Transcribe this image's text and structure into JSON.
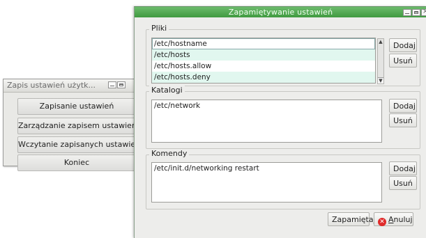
{
  "background_window": {
    "title": "Zapis ustawień użytk...",
    "buttons": [
      "Zapisanie ustawień",
      "Zarządzanie zapisem ustawień",
      "Wczytanie zapisanych ustawień",
      "Koniec"
    ]
  },
  "dialog": {
    "title": "Zapamiętywanie ustawień",
    "pliki": {
      "label": "Pliki",
      "items": [
        "/etc/hostname",
        "/etc/hosts",
        "/etc/hosts.allow",
        "/etc/hosts.deny"
      ],
      "add_label": "Dodaj",
      "remove_label": "Usuń"
    },
    "katalogi": {
      "label": "Katalogi",
      "items": [
        "/etc/network"
      ],
      "add_label": "Dodaj",
      "remove_label": "Usuń"
    },
    "komendy": {
      "label": "Komendy",
      "items": [
        "/etc/init.d/networking restart"
      ],
      "add_label": "Dodaj",
      "remove_label": "Usuń"
    },
    "save_label": "Zapamiętaj",
    "cancel_label_first": "A",
    "cancel_label_rest": "nuluj"
  },
  "colors": {
    "titlebar_active": "#4fa64f",
    "list_alt_row": "#e1f7ef",
    "cancel_icon": "#e02a2a"
  }
}
